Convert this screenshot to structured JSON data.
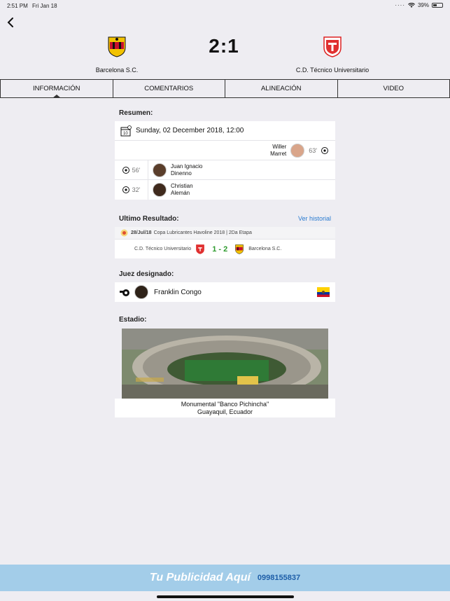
{
  "status_bar": {
    "time": "2:51 PM",
    "date": "Fri Jan 18",
    "battery": "39%"
  },
  "match": {
    "home_team": "Barcelona S.C.",
    "away_team": "C.D. Técnico Universitario",
    "score": "2:1"
  },
  "tabs": [
    {
      "label": "INFORMACIÓN",
      "active": true
    },
    {
      "label": "COMENTARIOS",
      "active": false
    },
    {
      "label": "ALINEACIÓN",
      "active": false
    },
    {
      "label": "VIDEO",
      "active": false
    }
  ],
  "summary": {
    "title": "Resumen:",
    "date": "Sunday, 02 December 2018, 12:00",
    "events": [
      {
        "side": "away",
        "player_line1": "Willer",
        "player_line2": "Marret",
        "minute": "63'"
      },
      {
        "side": "home",
        "player_line1": "Juan Ignacio",
        "player_line2": "Dinenno",
        "minute": "56'"
      },
      {
        "side": "home",
        "player_line1": "Christian",
        "player_line2": "Alemán",
        "minute": "32'"
      }
    ]
  },
  "last_result": {
    "title": "Ultimo Resultado:",
    "link": "Ver historial",
    "date": "28/Jul/18",
    "competition": "Copa Lubricantes Havoline 2018 | 2Da Etapa",
    "home": "C.D. Técnico Universitario",
    "score": "1 - 2",
    "away": "Barcelona S.C."
  },
  "referee": {
    "title": "Juez designado:",
    "name": "Franklin Congo"
  },
  "stadium": {
    "title": "Estadio:",
    "name": "Monumental \"Banco Pichincha\"",
    "location": "Guayaquil, Ecuador"
  },
  "ad": {
    "title": "Tu Publicidad Aquí",
    "phone": "0998155837"
  },
  "colors": {
    "accent": "#2a7bd0",
    "result_green": "#2e9b2e",
    "ad_bg": "#a3cde9"
  }
}
